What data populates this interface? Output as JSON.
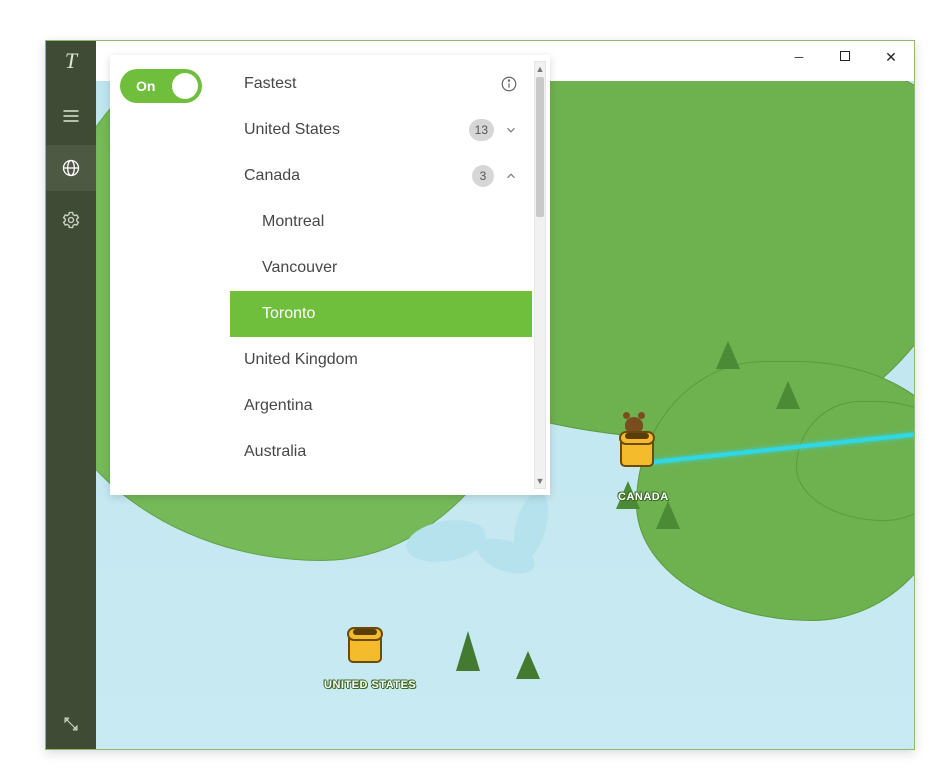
{
  "toggle": {
    "state": "On"
  },
  "list": {
    "fastest_label": "Fastest",
    "countries": {
      "us": {
        "label": "United States",
        "badge": "13",
        "expanded": false
      },
      "ca": {
        "label": "Canada",
        "badge": "3",
        "expanded": true,
        "cities": [
          "Montreal",
          "Vancouver",
          "Toronto"
        ],
        "selected_city": "Toronto"
      },
      "uk": {
        "label": "United Kingdom"
      },
      "ar": {
        "label": "Argentina"
      },
      "au": {
        "label": "Australia"
      }
    }
  },
  "map": {
    "labels": {
      "canada": "CANADA",
      "us": "UNITED STATES"
    }
  }
}
